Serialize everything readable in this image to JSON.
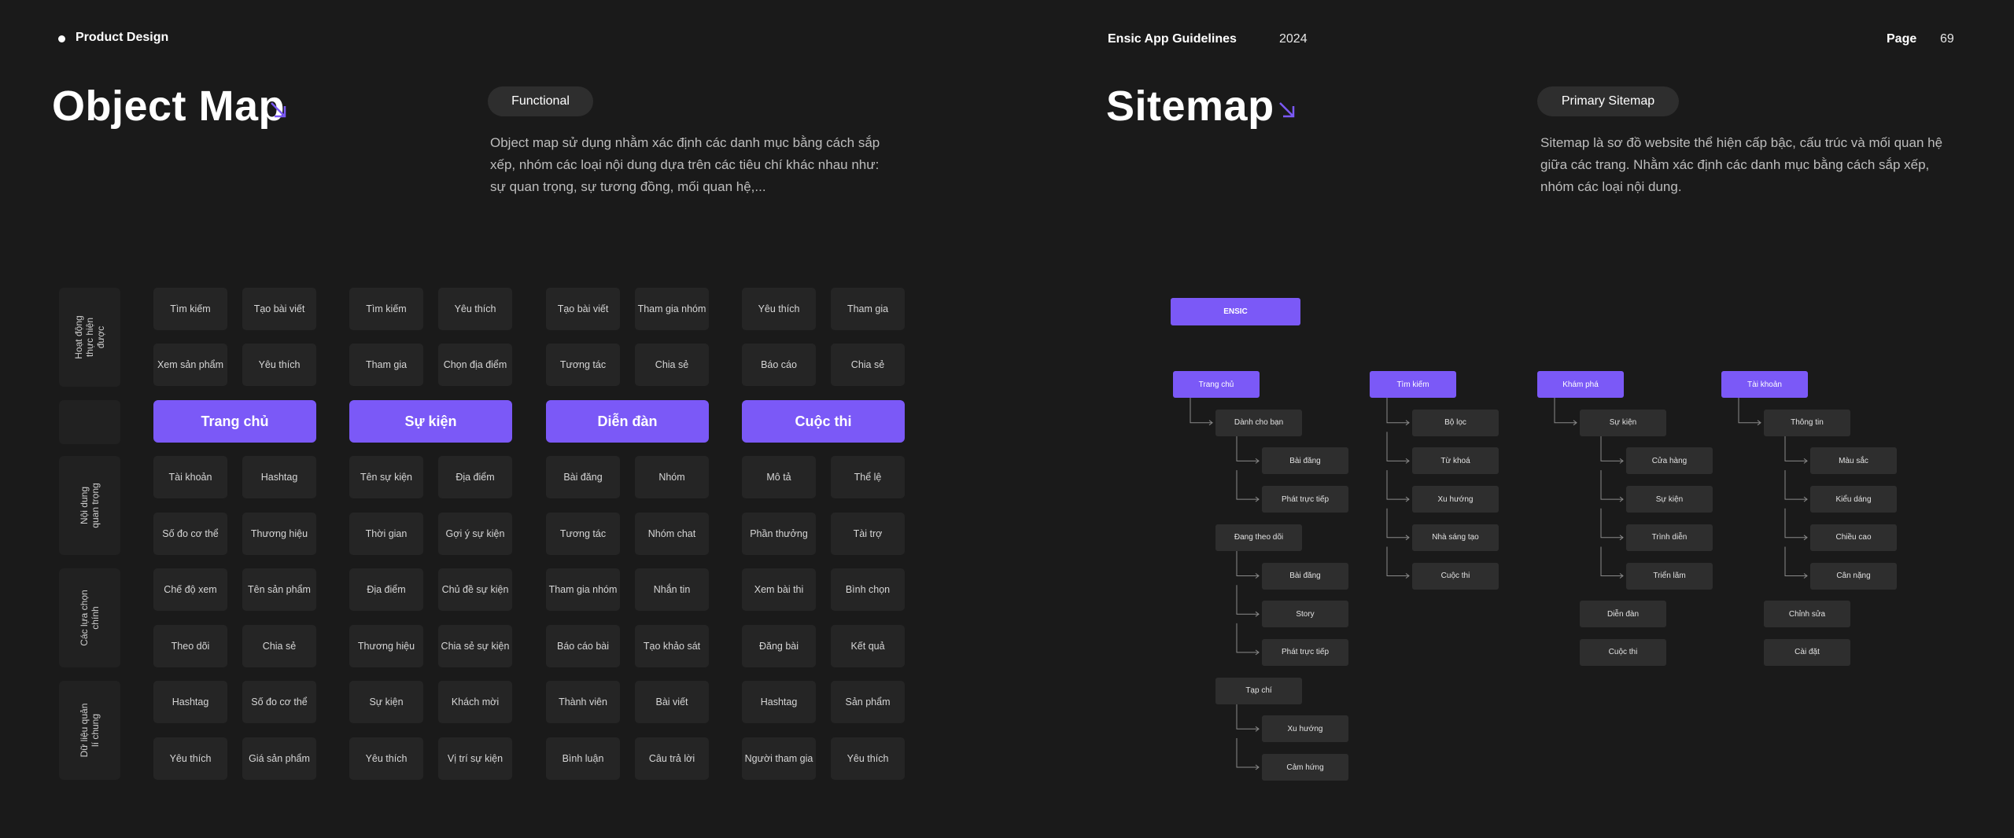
{
  "topbar": {
    "section": "Product Design",
    "guide_title": "Ensic App Guidelines",
    "year": "2024",
    "page_label": "Page",
    "page_number": "69"
  },
  "object_map": {
    "title": "Object Map",
    "tag": "Functional",
    "description_lines": [
      "Object map sử dụng nhằm xác định các danh mục bằng cách sắp",
      "xếp, nhóm các loại nội dung dựa trên các tiêu chí khác nhau như:",
      "sự quan trọng, sự tương đồng, mối quan hệ,..."
    ],
    "row_labels": [
      "Hoạt động thực hiện được",
      "",
      "Nội dung quan trọng",
      "Các lựa chọn chính",
      "Dữ liệu quản lí chung"
    ],
    "columns": [
      {
        "title": "Trang chủ",
        "top": [
          [
            "Tìm kiếm",
            "Tạo bài viết"
          ],
          [
            "Xem sản phẩm",
            "Yêu thích"
          ]
        ],
        "bottom": [
          [
            "Tài khoản",
            "Hashtag"
          ],
          [
            "Số đo cơ thể",
            "Thương hiệu"
          ],
          [
            "Chế độ xem",
            "Tên sản phẩm"
          ],
          [
            "Theo dõi",
            "Chia sẻ"
          ],
          [
            "Hashtag",
            "Số đo cơ thể"
          ],
          [
            "Yêu thích",
            "Giá sản phẩm"
          ]
        ]
      },
      {
        "title": "Sự kiện",
        "top": [
          [
            "Tìm kiếm",
            "Yêu thích"
          ],
          [
            "Tham gia",
            "Chọn địa điểm"
          ]
        ],
        "bottom": [
          [
            "Tên sự kiện",
            "Địa điểm"
          ],
          [
            "Thời gian",
            "Gợi ý sự kiện"
          ],
          [
            "Địa điểm",
            "Chủ đề sự kiện"
          ],
          [
            "Thương hiệu",
            "Chia sẻ sự kiện"
          ],
          [
            "Sự kiện",
            "Khách mời"
          ],
          [
            "Yêu thích",
            "Vị trí sự kiện"
          ]
        ]
      },
      {
        "title": "Diễn đàn",
        "top": [
          [
            "Tạo bài viết",
            "Tham gia nhóm"
          ],
          [
            "Tương tác",
            "Chia sẻ"
          ]
        ],
        "bottom": [
          [
            "Bài đăng",
            "Nhóm"
          ],
          [
            "Tương tác",
            "Nhóm chat"
          ],
          [
            "Tham gia nhóm",
            "Nhắn tin"
          ],
          [
            "Báo cáo bài",
            "Tạo khảo sát"
          ],
          [
            "Thành viên",
            "Bài viết"
          ],
          [
            "Bình luận",
            "Câu trả lời"
          ]
        ]
      },
      {
        "title": "Cuộc thi",
        "top": [
          [
            "Yêu thích",
            "Tham gia"
          ],
          [
            "Báo cáo",
            "Chia sẻ"
          ]
        ],
        "bottom": [
          [
            "Mô tả",
            "Thể lệ"
          ],
          [
            "Phần thưởng",
            "Tài trợ"
          ],
          [
            "Xem bài thi",
            "Bình chọn"
          ],
          [
            "Đăng bài",
            "Kết quả"
          ],
          [
            "Hashtag",
            "Sản phẩm"
          ],
          [
            "Người tham gia",
            "Yêu thích"
          ]
        ]
      }
    ]
  },
  "sitemap": {
    "title": "Sitemap",
    "tag": "Primary Sitemap",
    "description_lines": [
      "Sitemap là sơ đồ website thể hiện cấp bậc, cấu trúc và mối quan hệ",
      "giữa các trang. Nhằm xác định các danh mục bằng cách sắp xếp,",
      "nhóm các loại nội dung."
    ],
    "root": "ENSIC",
    "branches": [
      {
        "label": "Trang chủ",
        "groups": [
          {
            "label": "Dành cho bạn",
            "children": [
              "Bài đăng",
              "Phát trực tiếp"
            ]
          },
          {
            "label": "Đang theo dõi",
            "children": [
              "Bài đăng",
              "Story",
              "Phát trực tiếp"
            ]
          },
          {
            "label": "Tạp chí",
            "children": [
              "Xu hướng",
              "Cảm hứng"
            ]
          }
        ]
      },
      {
        "label": "Tìm kiếm",
        "groups": [],
        "items": [
          "Bộ lọc",
          "Từ khoá",
          "Xu hướng",
          "Nhà sáng tạo",
          "Cuộc thi"
        ]
      },
      {
        "label": "Khám phá",
        "groups": [
          {
            "label": "Sự kiện",
            "children": [
              "Cửa hàng",
              "Sự kiện",
              "Trình diễn",
              "Triển lãm"
            ]
          }
        ],
        "extras": [
          "Diễn đàn",
          "Cuộc thi"
        ]
      },
      {
        "label": "Tài khoản",
        "groups": [
          {
            "label": "Thông tin",
            "children": [
              "Màu sắc",
              "Kiểu dáng",
              "Chiều cao",
              "Cân nặng"
            ]
          }
        ],
        "extras": [
          "Chỉnh sửa",
          "Cài đặt"
        ]
      }
    ]
  },
  "colors": {
    "background": "#1a1a1a",
    "accent": "#7b59f7",
    "cell": "#252525",
    "node": "#2e2e2e"
  }
}
